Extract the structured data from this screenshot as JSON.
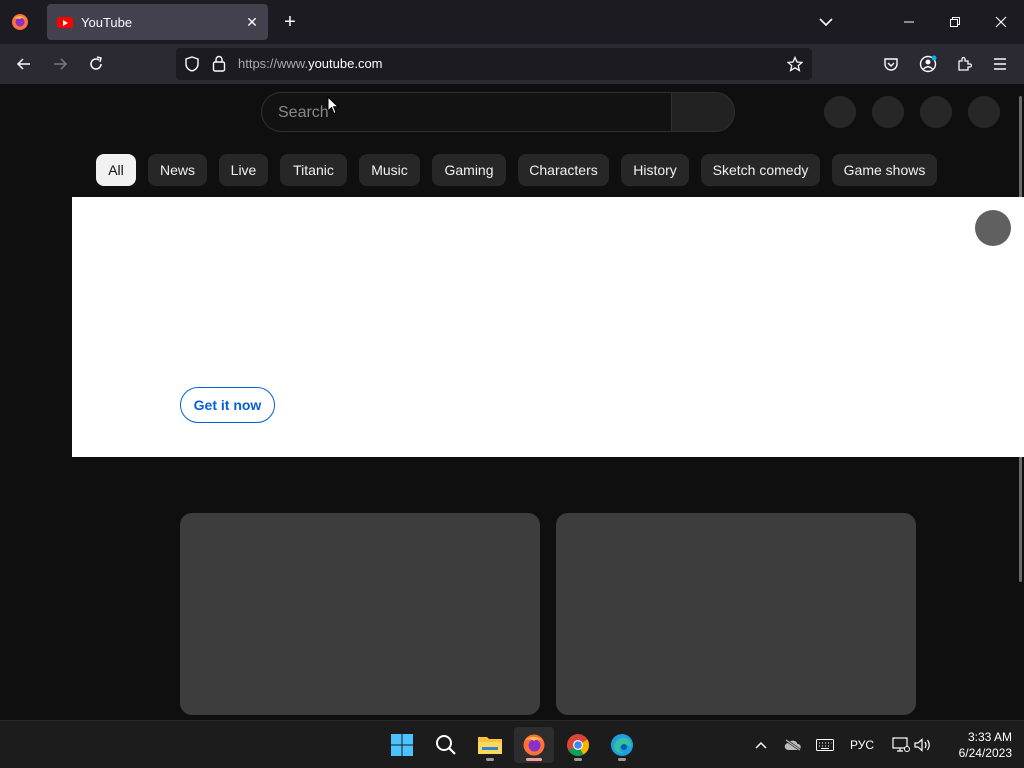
{
  "browser": {
    "tab": {
      "title": "YouTube",
      "close_glyph": "✕"
    },
    "new_tab_glyph": "+",
    "url_prefix": "https://www.",
    "url_domain": "youtube.com"
  },
  "youtube": {
    "search_placeholder": "Search",
    "chips": [
      "All",
      "News",
      "Live",
      "Titanic",
      "Music",
      "Gaming",
      "Characters",
      "History",
      "Sketch comedy",
      "Game shows"
    ],
    "banner_button": "Get it now"
  },
  "taskbar": {
    "language": "РУС",
    "time": "3:33 AM",
    "date": "6/24/2023"
  },
  "colors": {
    "youtube_background": "#0f0f0f",
    "chip_active": "#f1f1f1",
    "button_blue": "#065fd4"
  }
}
